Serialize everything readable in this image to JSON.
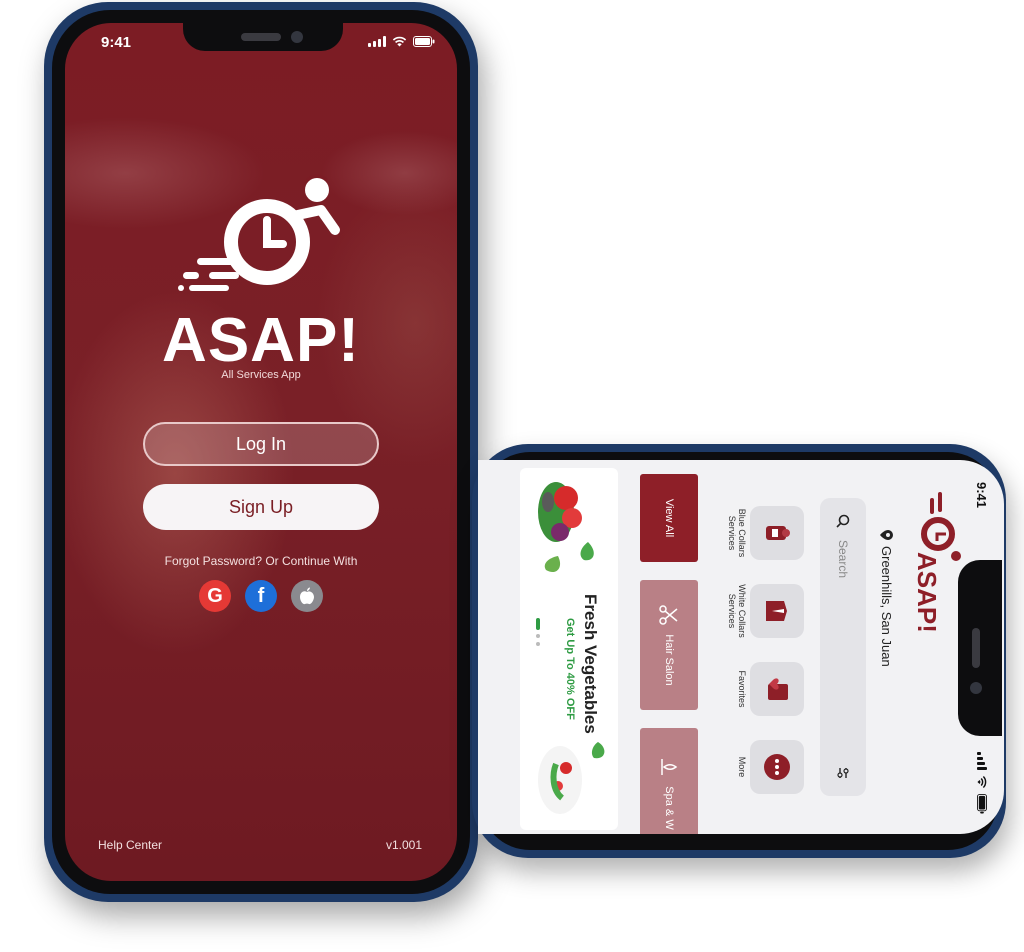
{
  "phone1": {
    "status": {
      "time": "9:41"
    },
    "app_name": "ASAP!",
    "tagline": "All Services App",
    "login_label": "Log In",
    "signup_label": "Sign Up",
    "forgot_text": "Forgot Password?  Or Continue With",
    "social_icons": [
      "google-icon",
      "facebook-icon",
      "apple-icon"
    ],
    "help_center": "Help Center",
    "version": "v1.001",
    "colors": {
      "brand": "#7c1c24",
      "google": "#e53935",
      "facebook": "#1e6fd9",
      "apple": "#8a8a8f"
    }
  },
  "phone2": {
    "status": {
      "time": "9:41"
    },
    "logo_text": "ASAP!",
    "location": "Greenhills, San Juan",
    "search_placeholder": "Search",
    "categories": [
      {
        "label": "Blue Collars Services",
        "icon": "uniform-icon"
      },
      {
        "label": "White Collars Services",
        "icon": "suit-icon"
      },
      {
        "label": "Favorites",
        "icon": "favorites-icon"
      },
      {
        "label": "More",
        "icon": "more-icon"
      }
    ],
    "service_tiles": [
      "View All",
      "Hair Salon",
      "Spa & W"
    ],
    "banner": {
      "title": "Fresh Vegetables",
      "subtitle": "Get Up To 40% OFF"
    },
    "colors": {
      "brand": "#8e1f28",
      "accent": "#2e9b43"
    }
  }
}
